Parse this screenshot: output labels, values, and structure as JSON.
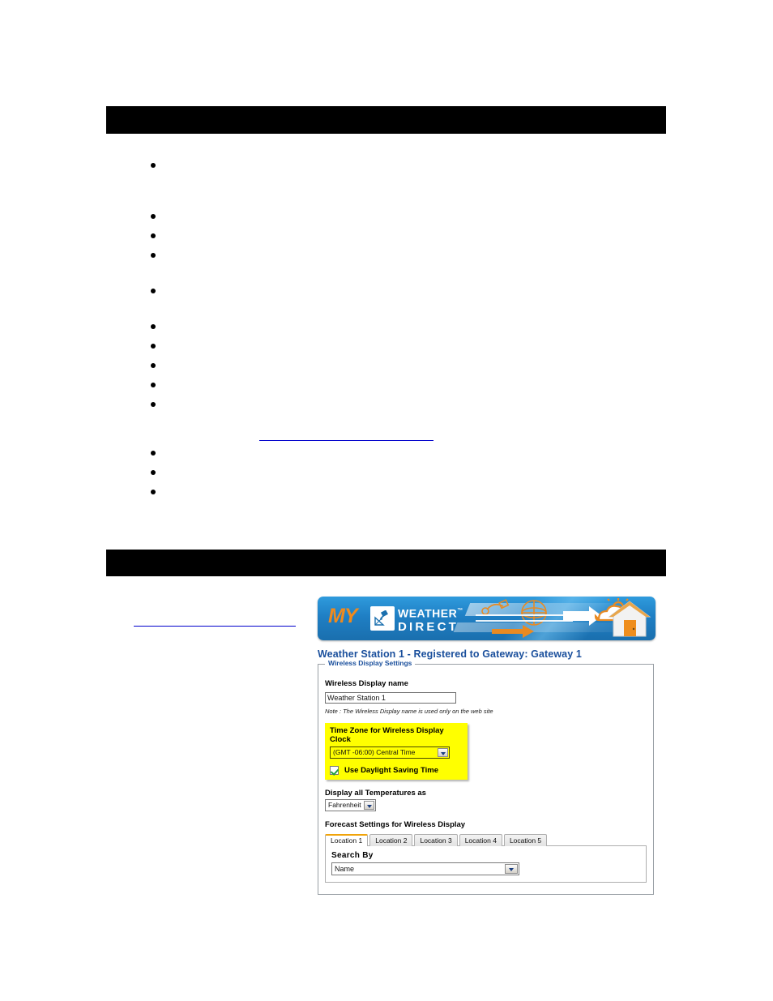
{
  "document": {
    "section_headers": [
      {
        "title": ""
      },
      {
        "title": ""
      }
    ],
    "bullet_groups": [
      {
        "items": [
          {
            "text": ""
          }
        ]
      },
      {
        "items": [
          {
            "text": ""
          },
          {
            "text": ""
          },
          {
            "text": ""
          }
        ]
      },
      {
        "items": [
          {
            "text": ""
          }
        ]
      },
      {
        "items": [
          {
            "text": ""
          },
          {
            "text": ""
          },
          {
            "text": ""
          },
          {
            "text": ""
          },
          {
            "text": ""
          }
        ]
      },
      {
        "items": [
          {
            "text": ""
          },
          {
            "text": ""
          },
          {
            "text": ""
          }
        ]
      }
    ],
    "links": [
      {
        "text": ""
      },
      {
        "text": ""
      }
    ]
  },
  "screenshot": {
    "banner": {
      "my_text": "MY",
      "weather_text": "WEATHER",
      "trademark": "™",
      "direct_text": "DIRECT",
      "icon_dish": "satellite-dish-icon",
      "icon_house": "house-icon",
      "colors": {
        "orange": "#f08a1c",
        "blue_dark": "#1a6fae",
        "blue_light": "#2f9bdd"
      }
    },
    "heading": "Weather Station 1 - Registered to Gateway: Gateway 1",
    "fieldset": {
      "legend": "Wireless Display Settings",
      "display_name": {
        "label": "Wireless Display name",
        "value": "Weather Station 1",
        "note": "Note : The Wireless Display name is used only on the web site"
      },
      "timezone": {
        "label": "Time Zone for Wireless Display Clock",
        "selected": "(GMT -06:00) Central Time",
        "dst_label": "Use Daylight Saving Time",
        "dst_checked": true,
        "highlight_color": "#ffff00"
      },
      "temperature": {
        "label": "Display all Temperatures as",
        "selected": "Fahrenheit"
      },
      "forecast": {
        "label": "Forecast Settings for Wireless Display",
        "tabs": [
          {
            "label": "Location 1",
            "active": true
          },
          {
            "label": "Location 2",
            "active": false
          },
          {
            "label": "Location 3",
            "active": false
          },
          {
            "label": "Location 4",
            "active": false
          },
          {
            "label": "Location 5",
            "active": false
          }
        ],
        "active_tab_accent": "#f0a30a",
        "search_by": {
          "label": "Search By",
          "selected": "Name"
        }
      }
    }
  }
}
